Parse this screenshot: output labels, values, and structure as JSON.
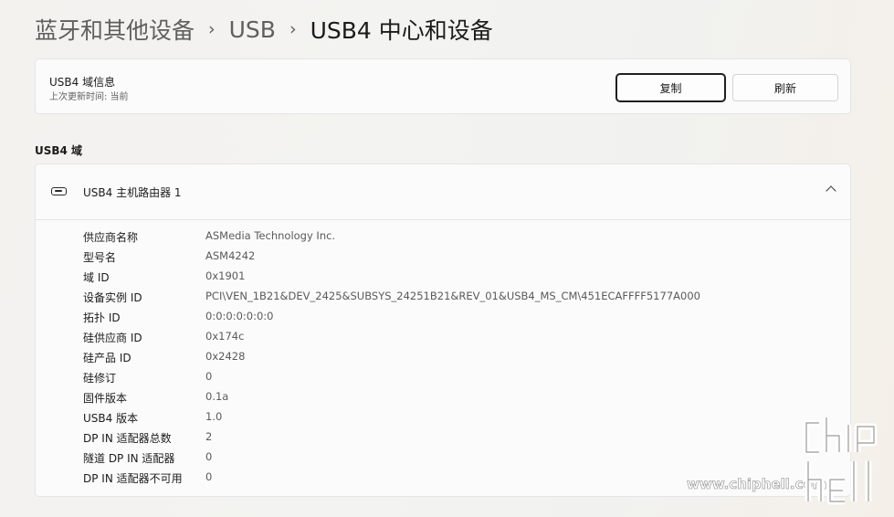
{
  "breadcrumb": {
    "items": [
      "蓝牙和其他设备",
      "USB",
      "USB4 中心和设备"
    ],
    "separator": "›"
  },
  "info_card": {
    "title": "USB4 域信息",
    "subtitle": "上次更新时间: 当前",
    "copy_label": "复制",
    "refresh_label": "刷新"
  },
  "section": {
    "title": "USB4 域"
  },
  "router": {
    "icon": "usb-port-icon",
    "title": "USB4 主机路由器 1",
    "expanded": true,
    "properties": [
      {
        "label": "供应商名称",
        "value": "ASMedia Technology Inc."
      },
      {
        "label": "型号名",
        "value": "ASM4242"
      },
      {
        "label": "域 ID",
        "value": "0x1901"
      },
      {
        "label": "设备实例 ID",
        "value": "PCI\\VEN_1B21&DEV_2425&SUBSYS_24251B21&REV_01&USB4_MS_CM\\451ECAFFFF5177A000"
      },
      {
        "label": "拓扑 ID",
        "value": "0:0:0:0:0:0:0"
      },
      {
        "label": "硅供应商 ID",
        "value": "0x174c"
      },
      {
        "label": "硅产品 ID",
        "value": "0x2428"
      },
      {
        "label": "硅修订",
        "value": "0"
      },
      {
        "label": "固件版本",
        "value": "0.1a"
      },
      {
        "label": "USB4 版本",
        "value": "1.0"
      },
      {
        "label": "DP IN 适配器总数",
        "value": "2"
      },
      {
        "label": "隧道 DP IN 适配器",
        "value": "0"
      },
      {
        "label": "DP IN 适配器不可用",
        "value": "0"
      }
    ]
  },
  "watermark": {
    "url": "www.chiphell.com",
    "logo_text": "chip hell"
  }
}
